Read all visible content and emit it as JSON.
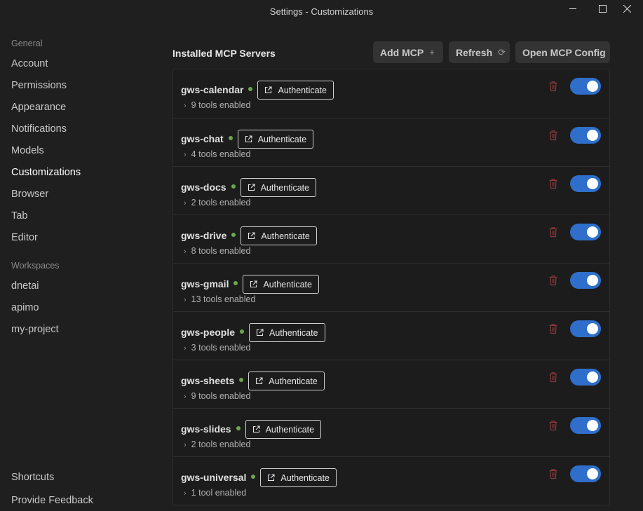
{
  "window": {
    "title": "Settings - Customizations"
  },
  "sidebar": {
    "general_label": "General",
    "general_items": [
      {
        "label": "Account"
      },
      {
        "label": "Permissions"
      },
      {
        "label": "Appearance"
      },
      {
        "label": "Notifications"
      },
      {
        "label": "Models"
      },
      {
        "label": "Customizations",
        "active": true
      },
      {
        "label": "Browser"
      },
      {
        "label": "Tab"
      },
      {
        "label": "Editor"
      }
    ],
    "workspaces_label": "Workspaces",
    "workspace_items": [
      {
        "label": "dnetai"
      },
      {
        "label": "apimo"
      },
      {
        "label": "my-project"
      }
    ],
    "footer_items": [
      {
        "label": "Shortcuts"
      },
      {
        "label": "Provide Feedback"
      }
    ]
  },
  "main": {
    "title": "Installed MCP Servers",
    "add_mcp_label": "Add MCP",
    "add_mcp_icon": "+",
    "refresh_label": "Refresh",
    "refresh_icon": "⟳",
    "open_config_label": "Open MCP Config",
    "authenticate_label": "Authenticate",
    "accent_color": "#2f6fcb",
    "status_color": "#6aa84f",
    "servers": [
      {
        "name": "gws-calendar",
        "tools": "9 tools enabled",
        "enabled": true
      },
      {
        "name": "gws-chat",
        "tools": "4 tools enabled",
        "enabled": true
      },
      {
        "name": "gws-docs",
        "tools": "2 tools enabled",
        "enabled": true
      },
      {
        "name": "gws-drive",
        "tools": "8 tools enabled",
        "enabled": true
      },
      {
        "name": "gws-gmail",
        "tools": "13 tools enabled",
        "enabled": true
      },
      {
        "name": "gws-people",
        "tools": "3 tools enabled",
        "enabled": true
      },
      {
        "name": "gws-sheets",
        "tools": "9 tools enabled",
        "enabled": true
      },
      {
        "name": "gws-slides",
        "tools": "2 tools enabled",
        "enabled": true
      },
      {
        "name": "gws-universal",
        "tools": "1 tool enabled",
        "enabled": true
      }
    ]
  }
}
